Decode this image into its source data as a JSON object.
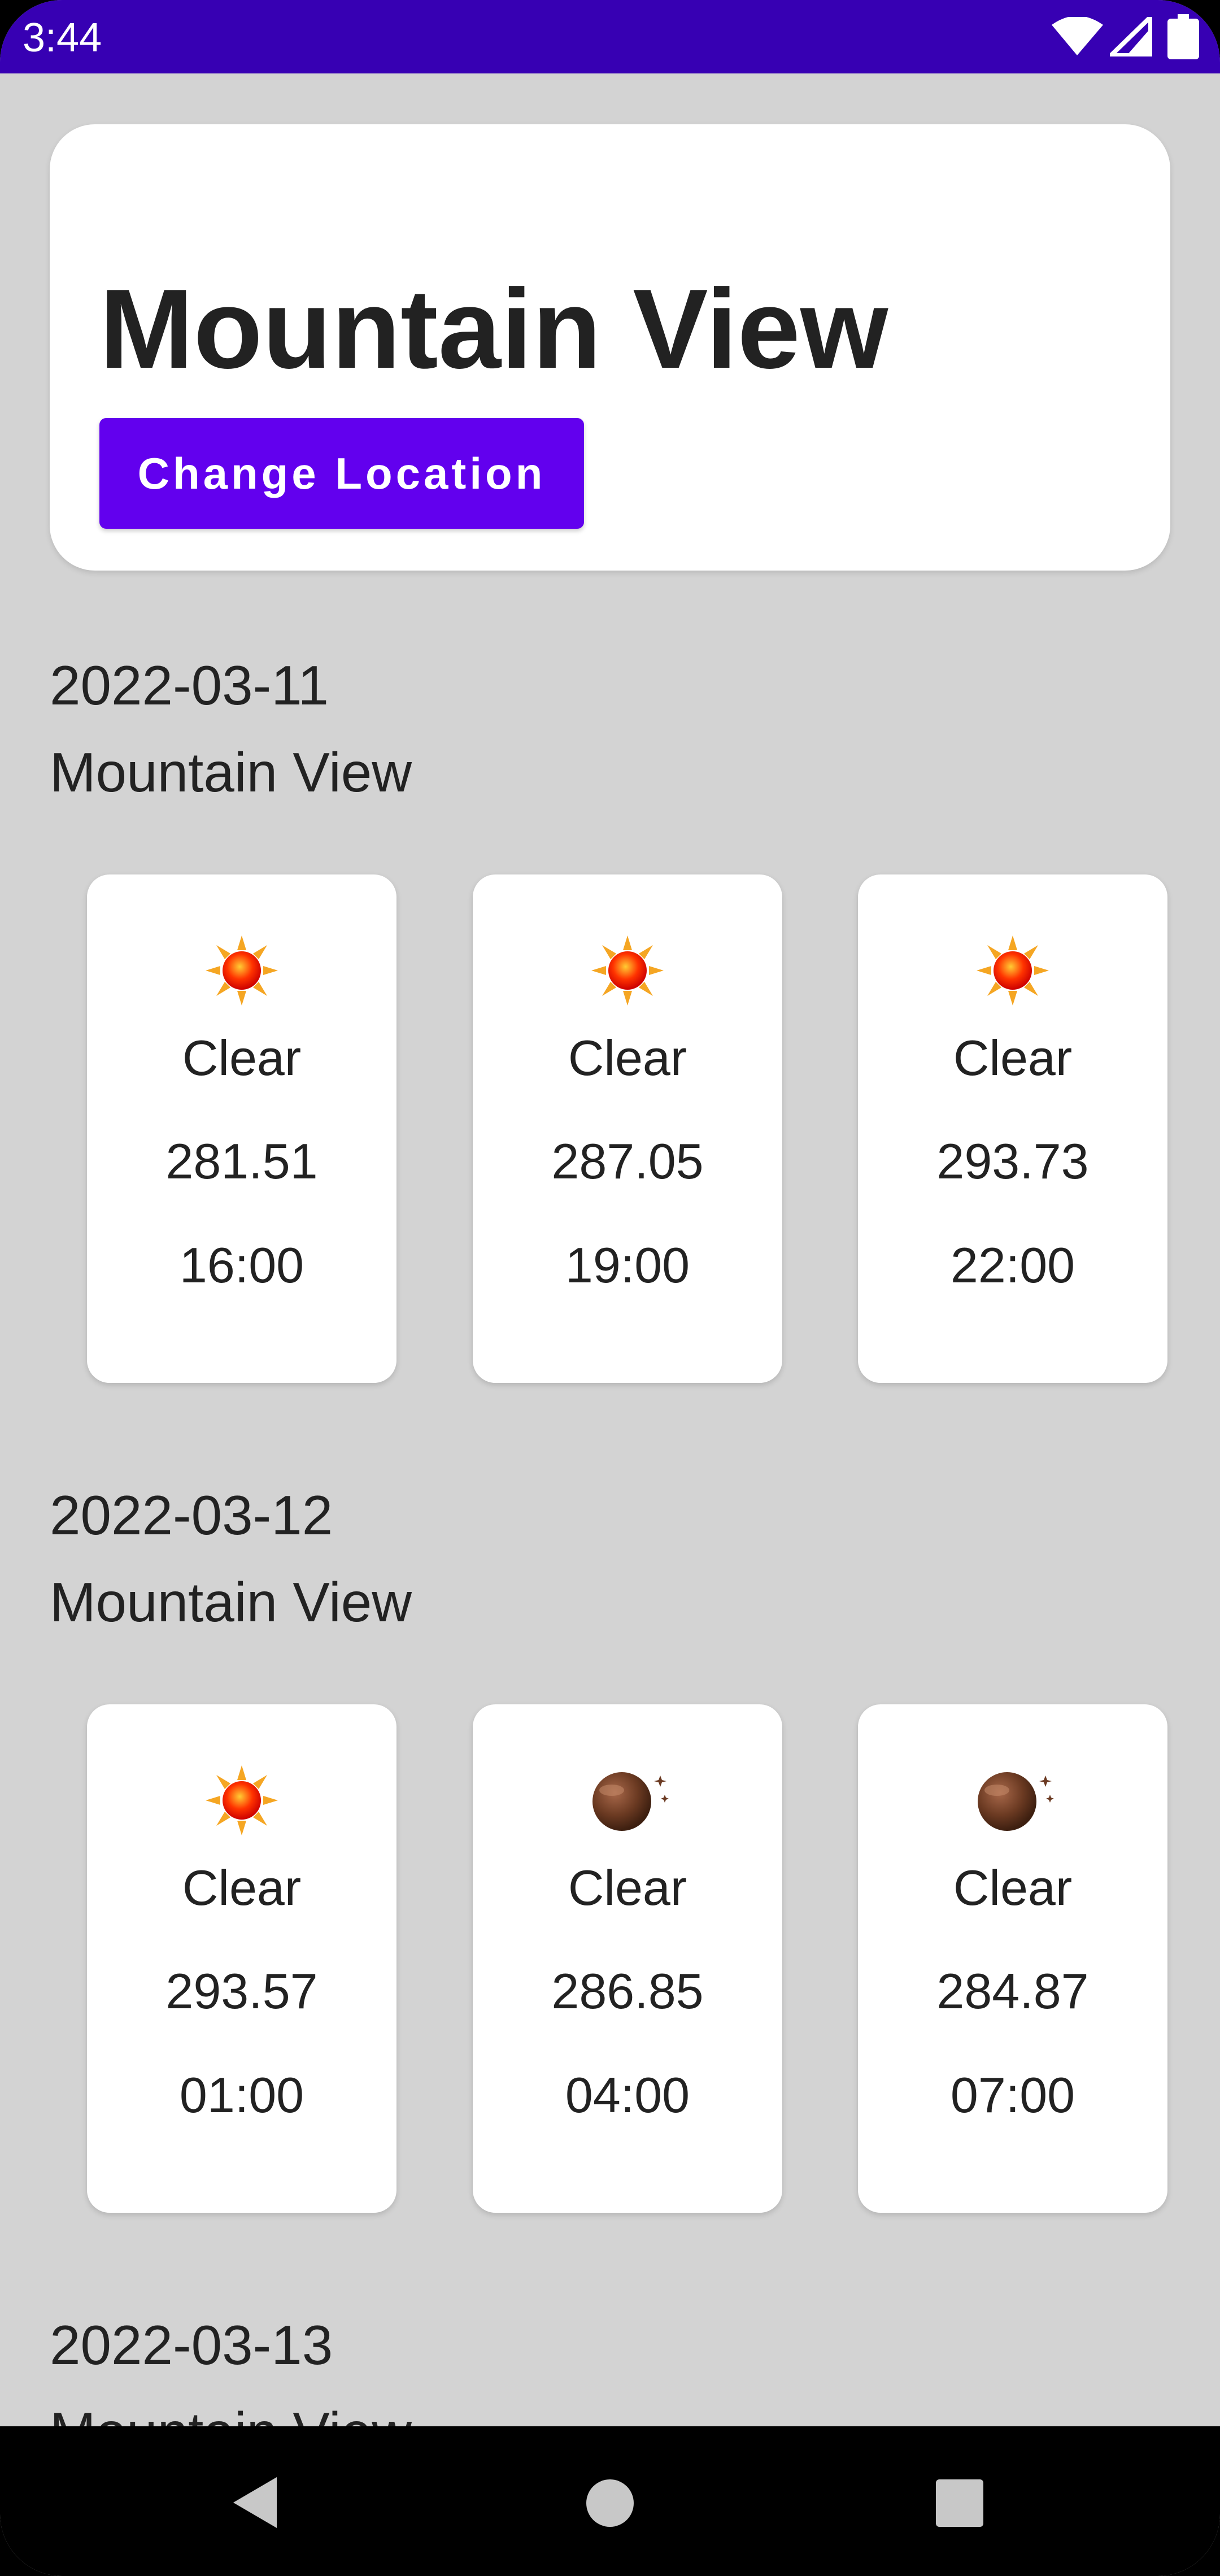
{
  "status_bar": {
    "time": "3:44",
    "icons": [
      "wifi-icon",
      "cellular-signal-icon",
      "battery-icon"
    ],
    "color": "#3700b3"
  },
  "header": {
    "city": "Mountain View",
    "change_location_label": "Change Location",
    "button_color": "#6200ee"
  },
  "days": [
    {
      "date": "2022-03-11",
      "city": "Mountain View",
      "forecasts": [
        {
          "icon": "sun-icon",
          "condition": "Clear",
          "temp": "281.51",
          "time": "16:00"
        },
        {
          "icon": "sun-icon",
          "condition": "Clear",
          "temp": "287.05",
          "time": "19:00"
        },
        {
          "icon": "sun-icon",
          "condition": "Clear",
          "temp": "293.73",
          "time": "22:00"
        }
      ]
    },
    {
      "date": "2022-03-12",
      "city": "Mountain View",
      "forecasts": [
        {
          "icon": "sun-icon",
          "condition": "Clear",
          "temp": "293.57",
          "time": "01:00"
        },
        {
          "icon": "moon-icon",
          "condition": "Clear",
          "temp": "286.85",
          "time": "04:00"
        },
        {
          "icon": "moon-icon",
          "condition": "Clear",
          "temp": "284.87",
          "time": "07:00"
        }
      ]
    },
    {
      "date": "2022-03-13",
      "city": "Mountain View",
      "forecasts": []
    }
  ],
  "nav_bar": {
    "buttons": [
      "back-icon",
      "home-icon",
      "recents-icon"
    ]
  }
}
